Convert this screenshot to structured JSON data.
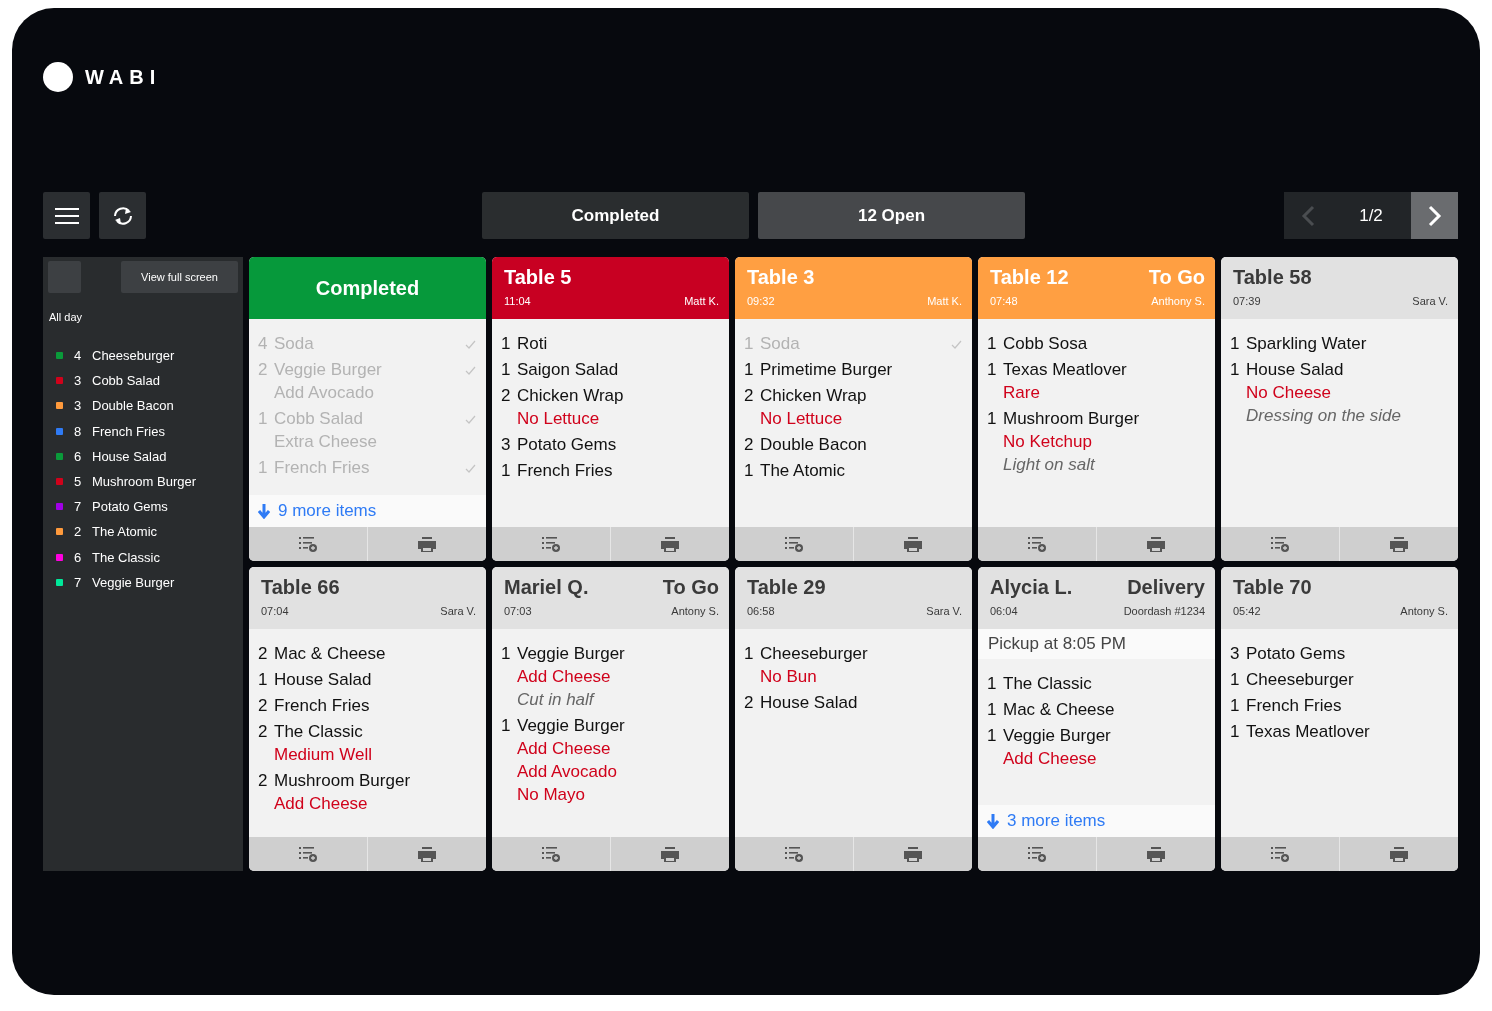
{
  "logo": {
    "text": "WABI"
  },
  "toolbar": {
    "tabs": [
      {
        "label": "Completed",
        "selected": false
      },
      {
        "label": "12 Open",
        "selected": true
      }
    ],
    "pager": {
      "label": "1/2",
      "prev_disabled": true,
      "next_disabled": false
    }
  },
  "sidebar": {
    "button": "View full screen",
    "heading": "All day",
    "items": [
      {
        "count": "4",
        "name": "Cheeseburger",
        "color": "#0a9a3a"
      },
      {
        "count": "3",
        "name": "Cobb Salad",
        "color": "#d0021b"
      },
      {
        "count": "3",
        "name": "Double Bacon",
        "color": "#ff9a3c"
      },
      {
        "count": "8",
        "name": "French Fries",
        "color": "#2f7bf5"
      },
      {
        "count": "6",
        "name": "House Salad",
        "color": "#0a9a3a"
      },
      {
        "count": "5",
        "name": "Mushroom Burger",
        "color": "#d0021b"
      },
      {
        "count": "7",
        "name": "Potato Gems",
        "color": "#a100e8"
      },
      {
        "count": "2",
        "name": "The Atomic",
        "color": "#ff9a3c"
      },
      {
        "count": "6",
        "name": "The Classic",
        "color": "#ff00e0"
      },
      {
        "count": "7",
        "name": "Veggie Burger",
        "color": "#00e89a"
      }
    ]
  },
  "tickets": [
    {
      "color": "#06993b",
      "centered": true,
      "title": "Completed",
      "items": [
        {
          "qty": "4",
          "name": "Soda",
          "done": true
        },
        {
          "qty": "2",
          "name": "Veggie Burger",
          "done": true,
          "mods": [
            {
              "kind": "mod",
              "text": "Add Avocado"
            }
          ]
        },
        {
          "qty": "1",
          "name": "Cobb Salad",
          "done": true,
          "mods": [
            {
              "kind": "mod",
              "text": "Extra Cheese"
            }
          ]
        },
        {
          "qty": "1",
          "name": "French Fries",
          "done": true
        }
      ],
      "more": "9 more items"
    },
    {
      "color": "#c80022",
      "title": "Table 5",
      "time": "11:04",
      "server": "Matt K.",
      "items": [
        {
          "qty": "1",
          "name": "Roti",
          "done": false
        },
        {
          "qty": "1",
          "name": "Saigon Salad",
          "done": false
        },
        {
          "qty": "2",
          "name": "Chicken Wrap",
          "done": false,
          "mods": [
            {
              "kind": "mod",
              "text": "No Lettuce"
            }
          ]
        },
        {
          "qty": "3",
          "name": "Potato Gems",
          "done": false
        },
        {
          "qty": "1",
          "name": "French Fries",
          "done": false
        }
      ]
    },
    {
      "color": "#ff9f42",
      "title": "Table 3",
      "time": "09:32",
      "server": "Matt K.",
      "items": [
        {
          "qty": "1",
          "name": "Soda",
          "done": true
        },
        {
          "qty": "1",
          "name": "Primetime Burger",
          "done": false
        },
        {
          "qty": "2",
          "name": "Chicken Wrap",
          "done": false,
          "mods": [
            {
              "kind": "mod",
              "text": "No Lettuce"
            }
          ]
        },
        {
          "qty": "2",
          "name": "Double Bacon",
          "done": false
        },
        {
          "qty": "1",
          "name": "The Atomic",
          "done": false
        }
      ]
    },
    {
      "color": "#ff9f42",
      "title": "Table 12",
      "tag": "To Go",
      "time": "07:48",
      "server": "Anthony S.",
      "items": [
        {
          "qty": "1",
          "name": "Cobb Sosa",
          "done": false
        },
        {
          "qty": "1",
          "name": "Texas Meatlover",
          "done": false,
          "mods": [
            {
              "kind": "mod",
              "text": "Rare"
            }
          ]
        },
        {
          "qty": "1",
          "name": "Mushroom Burger",
          "done": false,
          "mods": [
            {
              "kind": "mod",
              "text": "No Ketchup"
            },
            {
              "kind": "note",
              "text": "Light on salt"
            }
          ]
        }
      ]
    },
    {
      "color": "#e1e1e1",
      "title": "Table 58",
      "time": "07:39",
      "server": "Sara V.",
      "items": [
        {
          "qty": "1",
          "name": "Sparkling Water",
          "done": false
        },
        {
          "qty": "1",
          "name": "House Salad",
          "done": false,
          "mods": [
            {
              "kind": "mod",
              "text": "No Cheese"
            },
            {
              "kind": "note",
              "text": "Dressing on the side"
            }
          ]
        }
      ]
    },
    {
      "color": "#e1e1e1",
      "title": "Table 66",
      "time": "07:04",
      "server": "Sara V.",
      "items": [
        {
          "qty": "2",
          "name": "Mac & Cheese",
          "done": false
        },
        {
          "qty": "1",
          "name": "House Salad",
          "done": false
        },
        {
          "qty": "2",
          "name": "French Fries",
          "done": false
        },
        {
          "qty": "2",
          "name": "The Classic",
          "done": false,
          "mods": [
            {
              "kind": "mod",
              "text": "Medium Well"
            }
          ]
        },
        {
          "qty": "2",
          "name": "Mushroom Burger",
          "done": false,
          "mods": [
            {
              "kind": "mod",
              "text": "Add Cheese"
            }
          ]
        }
      ]
    },
    {
      "color": "#e1e1e1",
      "title": "Mariel Q.",
      "tag": "To Go",
      "time": "07:03",
      "server": "Antony S.",
      "items": [
        {
          "qty": "1",
          "name": "Veggie Burger",
          "done": false,
          "mods": [
            {
              "kind": "mod",
              "text": "Add Cheese"
            },
            {
              "kind": "note",
              "text": "Cut in half"
            }
          ]
        },
        {
          "qty": "1",
          "name": "Veggie Burger",
          "done": false,
          "mods": [
            {
              "kind": "mod",
              "text": "Add Cheese"
            },
            {
              "kind": "mod",
              "text": "Add Avocado"
            },
            {
              "kind": "mod",
              "text": "No Mayo"
            }
          ]
        }
      ]
    },
    {
      "color": "#e1e1e1",
      "title": "Table 29",
      "time": "06:58",
      "server": "Sara V.",
      "items": [
        {
          "qty": "1",
          "name": "Cheeseburger",
          "done": false,
          "mods": [
            {
              "kind": "mod",
              "text": "No Bun"
            }
          ]
        },
        {
          "qty": "2",
          "name": "House Salad",
          "done": false
        }
      ]
    },
    {
      "color": "#e1e1e1",
      "title": "Alycia L.",
      "tag": "Delivery",
      "time": "06:04",
      "server": "Doordash #1234",
      "pickup": "Pickup at 8:05 PM",
      "items": [
        {
          "qty": "1",
          "name": "The Classic",
          "done": false
        },
        {
          "qty": "1",
          "name": "Mac & Cheese",
          "done": false
        },
        {
          "qty": "1",
          "name": "Veggie Burger",
          "done": false,
          "mods": [
            {
              "kind": "mod",
              "text": "Add Cheese"
            }
          ]
        }
      ],
      "more": "3 more items"
    },
    {
      "color": "#e1e1e1",
      "title": "Table 70",
      "time": "05:42",
      "server": "Antony S.",
      "items": [
        {
          "qty": "3",
          "name": "Potato Gems",
          "done": false
        },
        {
          "qty": "1",
          "name": "Cheeseburger",
          "done": false
        },
        {
          "qty": "1",
          "name": "French Fries",
          "done": false
        },
        {
          "qty": "1",
          "name": "Texas Meatlover",
          "done": false
        }
      ]
    }
  ]
}
